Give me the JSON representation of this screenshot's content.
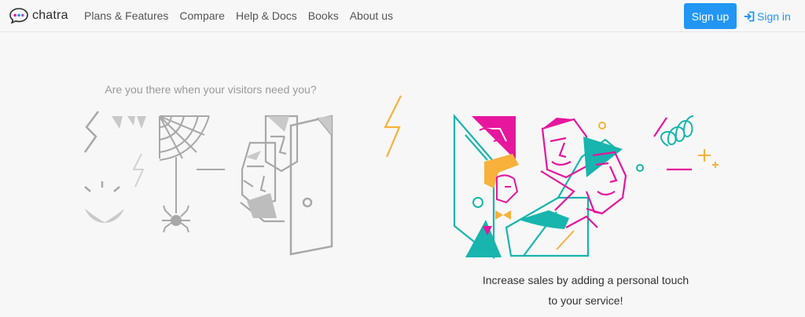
{
  "brand": {
    "name": "chatra",
    "logo_icon": "chat-bubble-dots-icon"
  },
  "nav": {
    "items": [
      {
        "label": "Plans & Features"
      },
      {
        "label": "Compare"
      },
      {
        "label": "Help & Docs"
      },
      {
        "label": "Books"
      },
      {
        "label": "About us"
      }
    ]
  },
  "auth": {
    "signup_label": "Sign up",
    "signin_label": "Sign in",
    "signin_icon": "sign-in-arrow-icon"
  },
  "hero": {
    "question": "Are you there when your visitors need you?",
    "tagline_line1": "Increase sales by adding a personal touch",
    "tagline_line2": "to your service!"
  },
  "colors": {
    "accent": "#2196f3",
    "magenta": "#e6169d",
    "teal": "#17b5ad",
    "orange": "#f8b13a",
    "gray_art": "#a8a8a8"
  }
}
